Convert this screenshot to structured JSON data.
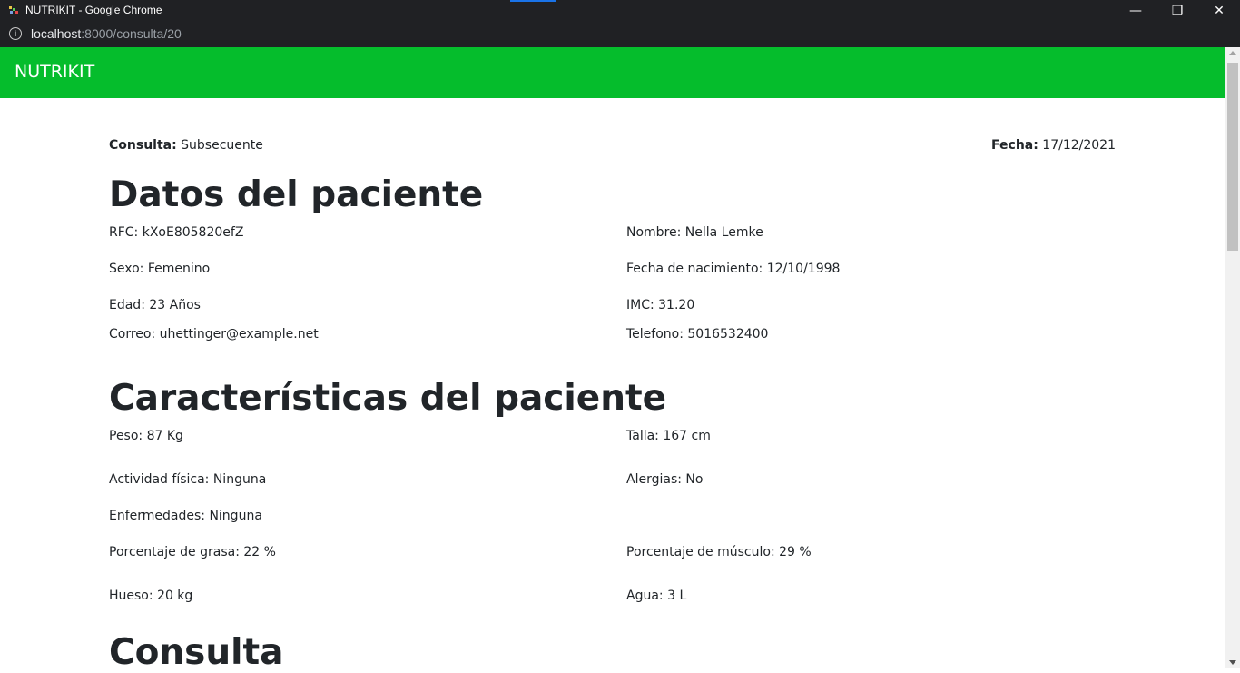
{
  "browser": {
    "window_title": "NUTRIKIT - Google Chrome",
    "url_host": "localhost",
    "url_path": ":8000/consulta/20",
    "minimize_glyph": "—",
    "restore_glyph": "❐",
    "close_glyph": "✕"
  },
  "navbar": {
    "brand": "NUTRIKIT",
    "color": "#05bd2c"
  },
  "header": {
    "consulta_label": "Consulta:",
    "consulta_value": "Subsecuente",
    "fecha_label": "Fecha:",
    "fecha_value": "17/12/2021"
  },
  "datos": {
    "heading": "Datos del paciente",
    "rfc": "RFC: kXoE805820efZ",
    "nombre": "Nombre: Nella Lemke",
    "sexo": "Sexo: Femenino",
    "fecha_nacimiento": "Fecha de nacimiento: 12/10/1998",
    "edad": "Edad: 23 Años",
    "imc": "IMC: 31.20",
    "correo": "Correo: uhettinger@example.net",
    "telefono": "Telefono: 5016532400"
  },
  "caracteristicas": {
    "heading": "Características del paciente",
    "peso": "Peso: 87 Kg",
    "talla": "Talla: 167 cm",
    "actividad": "Actividad física: Ninguna",
    "alergias": "Alergias: No",
    "enfermedades": "Enfermedades: Ninguna",
    "grasa": "Porcentaje de grasa: 22 %",
    "musculo": "Porcentaje de músculo: 29 %",
    "hueso": "Hueso: 20 kg",
    "agua": "Agua: 3 L"
  },
  "consulta": {
    "heading": "Consulta"
  }
}
